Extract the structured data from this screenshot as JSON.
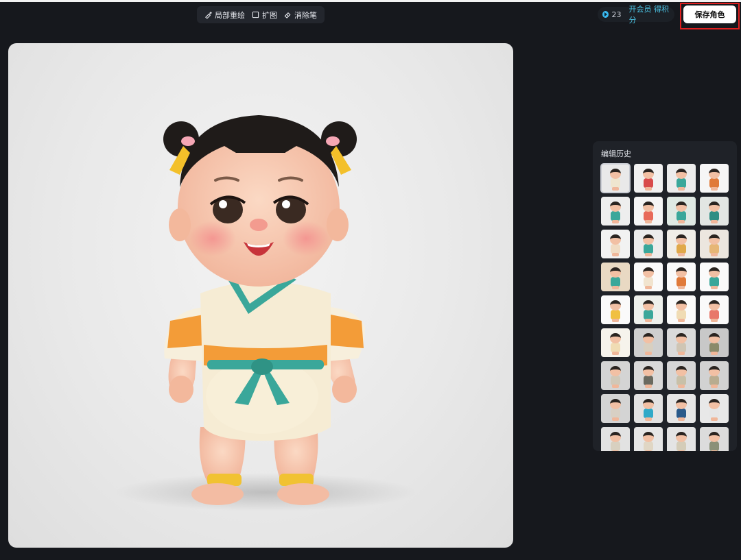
{
  "toolbar": {
    "tools": [
      {
        "label": "局部重绘",
        "icon": "brush-icon"
      },
      {
        "label": "扩图",
        "icon": "expand-frame-icon"
      },
      {
        "label": "消除笔",
        "icon": "eraser-icon"
      }
    ]
  },
  "credits": {
    "count": "23",
    "cta": "开会员 得积分",
    "icon": "credit-coin-icon",
    "color": "#3ab9f0"
  },
  "save_button": {
    "label": "保存角色",
    "highlight_color": "#e01f1f"
  },
  "canvas": {
    "subject": "chibi-baby-character",
    "background": "#ececec"
  },
  "history": {
    "title": "编辑历史",
    "selected_index": 0,
    "thumbnails": [
      {
        "bg": "#e9e9e9",
        "outfit": "#efe6cf"
      },
      {
        "bg": "#f1f1f1",
        "outfit": "#d84b4b"
      },
      {
        "bg": "#ececec",
        "outfit": "#3aa79a"
      },
      {
        "bg": "#f6f6f6",
        "outfit": "#e07a3a"
      },
      {
        "bg": "#eeeeee",
        "outfit": "#3aa79a"
      },
      {
        "bg": "#f5f5f5",
        "outfit": "#e86a5a"
      },
      {
        "bg": "#dfe9e3",
        "outfit": "#3aa79a"
      },
      {
        "bg": "#e2e6e3",
        "outfit": "#2f8e84"
      },
      {
        "bg": "#f2f2f2",
        "outfit": "#f0dcc4"
      },
      {
        "bg": "#ececec",
        "outfit": "#3aa79a"
      },
      {
        "bg": "#f0eee8",
        "outfit": "#e0a94a"
      },
      {
        "bg": "#ece6df",
        "outfit": "#e6b676"
      },
      {
        "bg": "#e9d9c3",
        "outfit": "#3aa79a"
      },
      {
        "bg": "#fafafa",
        "outfit": "#f1e4cf"
      },
      {
        "bg": "#fafafa",
        "outfit": "#e07a3a"
      },
      {
        "bg": "#fafafa",
        "outfit": "#3aa79a"
      },
      {
        "bg": "#fafafa",
        "outfit": "#f0c040"
      },
      {
        "bg": "#eef0ec",
        "outfit": "#3aa79a"
      },
      {
        "bg": "#fafafa",
        "outfit": "#f0dcb4"
      },
      {
        "bg": "#fafafa",
        "outfit": "#e8786a"
      },
      {
        "bg": "#f6f3ec",
        "outfit": "#f0dcb4"
      },
      {
        "bg": "#cfcfcf",
        "outfit": "#d8cfc0"
      },
      {
        "bg": "#dadada",
        "outfit": "#cfc5b4"
      },
      {
        "bg": "#c8c8c8",
        "outfit": "#8a8a6a"
      },
      {
        "bg": "#d4d4d4",
        "outfit": "#d0c8b8"
      },
      {
        "bg": "#d9d9d9",
        "outfit": "#6a6a60"
      },
      {
        "bg": "#d6d6d6",
        "outfit": "#c8c0a8"
      },
      {
        "bg": "#d2d2d2",
        "outfit": "#b8ac90"
      },
      {
        "bg": "#d4d4d4",
        "outfit": "#d8d0c4"
      },
      {
        "bg": "#e2e2e2",
        "outfit": "#2fa9c8"
      },
      {
        "bg": "#e6e6e6",
        "outfit": "#2a5a8a"
      },
      {
        "bg": "#e8e8e8",
        "outfit": "#e6e6e6"
      },
      {
        "bg": "#e2e2e2",
        "outfit": "#d8d0c0"
      },
      {
        "bg": "#e6e6e6",
        "outfit": "#e0d6c4"
      },
      {
        "bg": "#e4e4e4",
        "outfit": "#d4ccb8"
      },
      {
        "bg": "#dcdcdc",
        "outfit": "#8a9078"
      }
    ]
  }
}
